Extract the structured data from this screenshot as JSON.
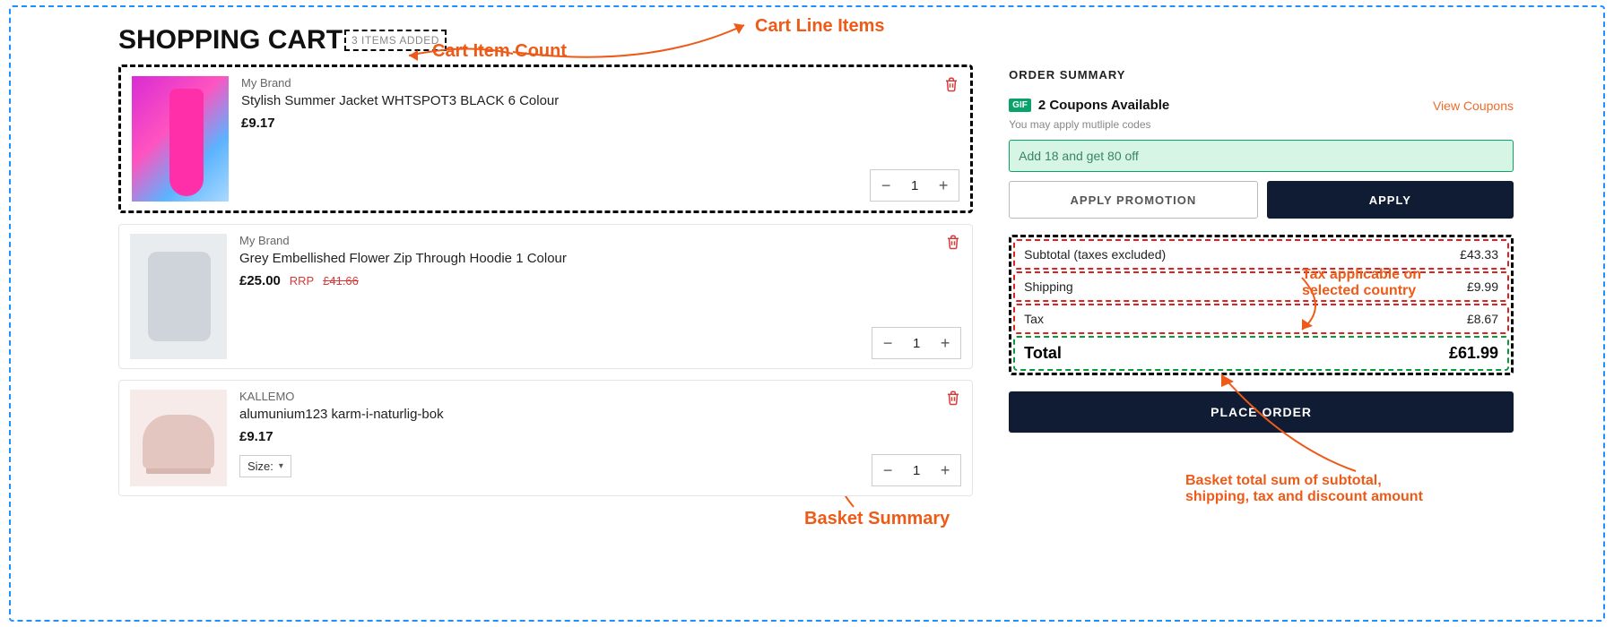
{
  "page": {
    "title": "SHOPPING CART",
    "count_label": "3 ITEMS ADDED"
  },
  "annotations": {
    "count": "Cart Item Count",
    "items": "Cart Line Items",
    "summary": "Basket Summary",
    "tax": "Tax applicable on selected country",
    "total": "Basket total sum of subtotal, shipping, tax and discount amount"
  },
  "items": [
    {
      "brand": "My Brand",
      "name": "Stylish Summer Jacket WHTSPOT3 BLACK 6 Colour",
      "price": "£9.17",
      "rrp_prefix": "",
      "rrp": "",
      "qty": "1",
      "size_label": ""
    },
    {
      "brand": "My Brand",
      "name": "Grey Embellished Flower Zip Through Hoodie 1 Colour",
      "price": "£25.00",
      "rrp_prefix": "RRP",
      "rrp": "£41.66",
      "qty": "1",
      "size_label": ""
    },
    {
      "brand": "KALLEMO",
      "name": "alumunium123 karm-i-naturlig-bok",
      "price": "£9.17",
      "rrp_prefix": "",
      "rrp": "",
      "qty": "1",
      "size_label": "Size:"
    }
  ],
  "summary": {
    "title": "ORDER SUMMARY",
    "coupons_badge": "GIF",
    "coupons_text": "2 Coupons Available",
    "view_coupons": "View Coupons",
    "hint": "You may apply mutliple codes",
    "promo_value": "Add 18 and get 80 off",
    "apply_promo_btn": "APPLY PROMOTION",
    "apply_btn": "APPLY",
    "rows": {
      "subtotal_label": "Subtotal (taxes excluded)",
      "subtotal_value": "£43.33",
      "shipping_label": "Shipping",
      "shipping_value": "£9.99",
      "tax_label": "Tax",
      "tax_value": "£8.67",
      "total_label": "Total",
      "total_value": "£61.99"
    },
    "place_order": "PLACE ORDER"
  }
}
